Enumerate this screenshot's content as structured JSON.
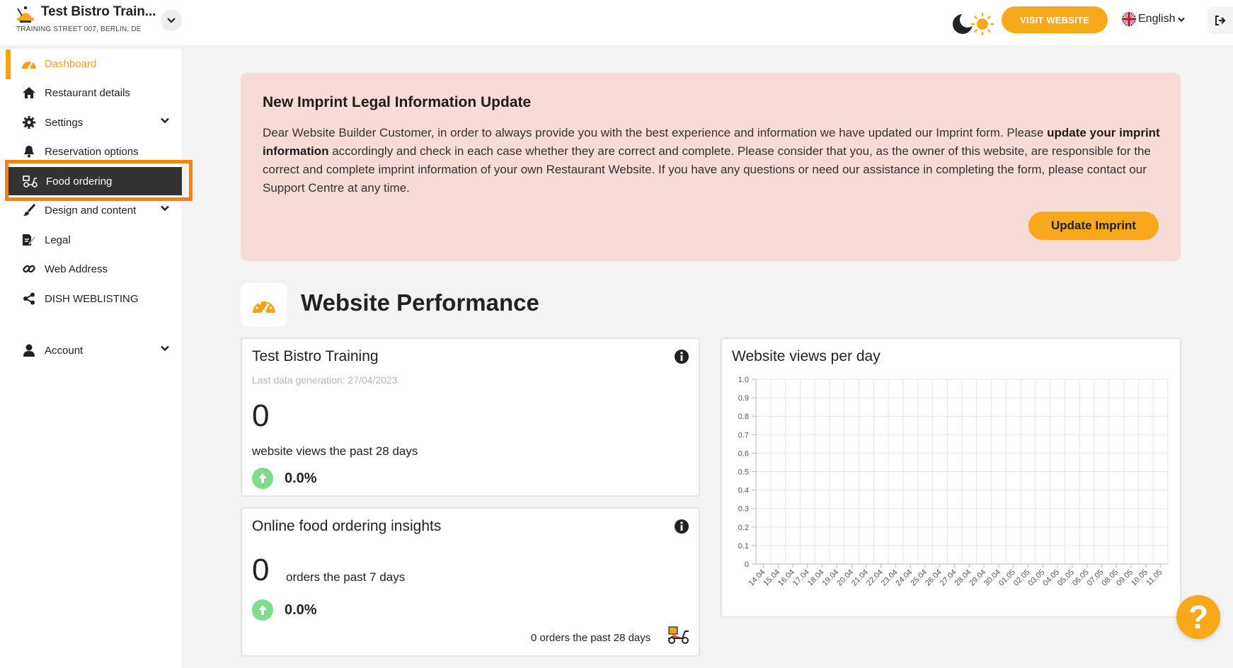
{
  "header": {
    "restaurant_name": "Test Bistro Train...",
    "restaurant_address": "TRAINING STREET 007, BERLIN, DE",
    "visit_website_label": "VISIT WEBSITE",
    "language_label": "English",
    "accent_color": "#f8a91b"
  },
  "sidebar": {
    "items": [
      {
        "label": "Dashboard",
        "icon": "speedometer-icon"
      },
      {
        "label": "Restaurant details",
        "icon": "home-icon"
      },
      {
        "label": "Settings",
        "icon": "gear-icon"
      },
      {
        "label": "Reservation options",
        "icon": "bell-icon"
      },
      {
        "label": "Food ordering",
        "icon": "scooter-icon"
      },
      {
        "label": "Design and content",
        "icon": "brush-icon"
      },
      {
        "label": "Legal",
        "icon": "document-edit-icon"
      },
      {
        "label": "Web Address",
        "icon": "link-icon"
      },
      {
        "label": "DISH WEBLISTING",
        "icon": "share-icon"
      },
      {
        "label": "Account",
        "icon": "user-icon"
      }
    ]
  },
  "notice": {
    "title": "New Imprint Legal Information Update",
    "text_before": "Dear Website Builder Customer, in order to always provide you with the best experience and information we have updated our Imprint form. Please ",
    "text_bold": "update your imprint information",
    "text_after": " accordingly and check in each case whether they are correct and complete. Please consider that you, as the owner of this website, are responsible for the correct and complete imprint information of your own Restaurant Website. If you have any questions or need our assistance in completing the form, please contact our Support Centre at any time.",
    "button_label": "Update Imprint",
    "bg_color": "#f7dbd6"
  },
  "performance": {
    "title": "Website Performance",
    "views_card": {
      "title": "Test Bistro Training",
      "last_generated": "Last data generation: 27/04/2023",
      "count": "0",
      "description": "website views the past 28 days",
      "change": "0.0%"
    },
    "orders_card": {
      "title": "Online food ordering insights",
      "count": "0",
      "description": "orders the past 7 days",
      "change": "0.0%",
      "footer": "0 orders the past 28 days"
    },
    "chart_card": {
      "title": "Website views per day"
    }
  },
  "chart_data": {
    "type": "line",
    "title": "Website views per day",
    "xlabel": "",
    "ylabel": "",
    "ylim": [
      0,
      1.0
    ],
    "yticks": [
      "0",
      "0.1",
      "0.2",
      "0.3",
      "0.4",
      "0.5",
      "0.6",
      "0.7",
      "0.8",
      "0.9",
      "1.0"
    ],
    "categories": [
      "14.04",
      "15.04",
      "16.04",
      "17.04",
      "18.04",
      "19.04",
      "20.04",
      "21.04",
      "22.04",
      "23.04",
      "24.04",
      "25.04",
      "26.04",
      "27.04",
      "28.04",
      "29.04",
      "30.04",
      "01.05",
      "02.05",
      "03.05",
      "04.05",
      "05.05",
      "06.05",
      "07.05",
      "08.05",
      "09.05",
      "10.05",
      "11.05"
    ],
    "series": [],
    "grid": true
  }
}
